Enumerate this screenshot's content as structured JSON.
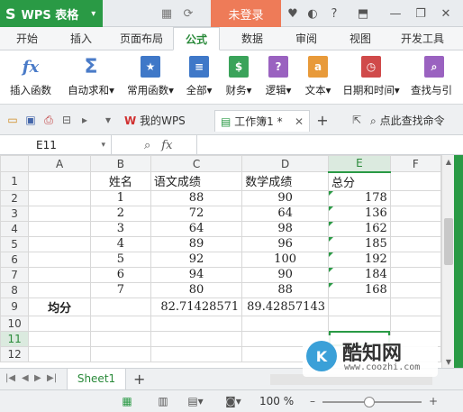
{
  "titlebar": {
    "app_name": "WPS 表格",
    "app_logo": "S",
    "login_label": "未登录",
    "icons": [
      "layout-icon",
      "sync-icon",
      "tshirt-icon",
      "skin-icon",
      "help-icon",
      "minimize-to-tray-icon",
      "restore-icon",
      "close-icon"
    ]
  },
  "tabs": [
    "开始",
    "插入",
    "页面布局",
    "公式",
    "数据",
    "审阅",
    "视图",
    "开发工具"
  ],
  "active_tab": "公式",
  "ribbon": [
    {
      "label": "插入函数",
      "glyph": "fx",
      "color": "#4a7bc8"
    },
    {
      "label": "自动求和",
      "glyph": "Σ",
      "color": "#4a7bc8",
      "dropdown": "▾"
    },
    {
      "label": "常用函数",
      "glyph": "★",
      "color": "#3f78c8",
      "dropdown": "▾"
    },
    {
      "label": "全部",
      "glyph": "≡",
      "color": "#3f78c8",
      "dropdown": "▾"
    },
    {
      "label": "财务",
      "glyph": "$",
      "color": "#3aa35a",
      "dropdown": "▾"
    },
    {
      "label": "逻辑",
      "glyph": "?",
      "color": "#9a62c0",
      "dropdown": "▾"
    },
    {
      "label": "文本",
      "glyph": "a",
      "color": "#e89a3a",
      "dropdown": "▾"
    },
    {
      "label": "日期和时间",
      "glyph": "◷",
      "color": "#d04a4a",
      "dropdown": "▾"
    },
    {
      "label": "查找与引",
      "glyph": "⌕",
      "color": "#9a62c0"
    }
  ],
  "doctabs": {
    "tab1": "我的WPS",
    "tab2": "工作簿1 *",
    "search_label": "点此查找命令"
  },
  "formulabar": {
    "namebox": "E11",
    "fx": "fx",
    "formula": ""
  },
  "sheet": {
    "columns": [
      "A",
      "B",
      "C",
      "D",
      "E",
      "F"
    ],
    "rows": [
      [
        "1",
        "",
        "姓名",
        "语文成绩",
        "数学成绩",
        "总分",
        ""
      ],
      [
        "2",
        "",
        "1",
        "88",
        "90",
        "178",
        ""
      ],
      [
        "3",
        "",
        "2",
        "72",
        "64",
        "136",
        ""
      ],
      [
        "4",
        "",
        "3",
        "64",
        "98",
        "162",
        ""
      ],
      [
        "5",
        "",
        "4",
        "89",
        "96",
        "185",
        ""
      ],
      [
        "6",
        "",
        "5",
        "92",
        "100",
        "192",
        ""
      ],
      [
        "7",
        "",
        "6",
        "94",
        "90",
        "184",
        ""
      ],
      [
        "8",
        "",
        "7",
        "80",
        "88",
        "168",
        ""
      ],
      [
        "9",
        "均分",
        "",
        "82.71428571",
        "89.42857143",
        "",
        ""
      ],
      [
        "10",
        "",
        "",
        "",
        "",
        "",
        ""
      ],
      [
        "11",
        "",
        "",
        "",
        "",
        "",
        ""
      ],
      [
        "12",
        "",
        "",
        "",
        "",
        "",
        ""
      ]
    ],
    "active_cell": "E11"
  },
  "sheetbar": {
    "sheet_name": "Sheet1",
    "add": "+"
  },
  "status": {
    "zoom": "100 %",
    "zoom_value": 100,
    "minus": "–",
    "plus": "+"
  },
  "watermark": {
    "logo": "K",
    "name": "酷知网",
    "url": "www.coozhi.com"
  }
}
